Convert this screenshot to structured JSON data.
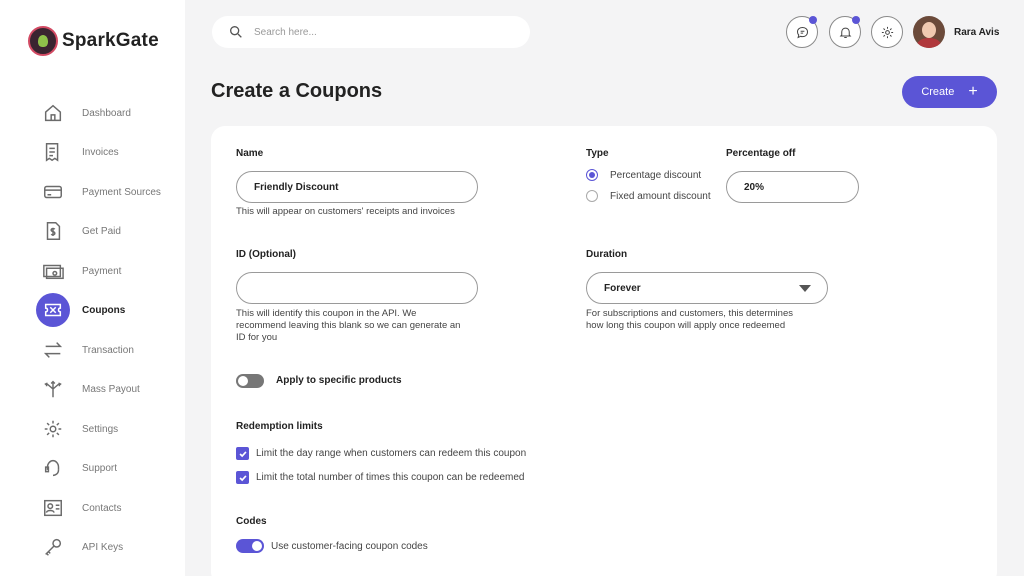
{
  "brand": {
    "name": "SparkGate"
  },
  "sidebar": {
    "items": [
      {
        "label": "Dashboard",
        "icon": "home-icon"
      },
      {
        "label": "Invoices",
        "icon": "invoice-icon"
      },
      {
        "label": "Payment Sources",
        "icon": "card-icon"
      },
      {
        "label": "Get Paid",
        "icon": "dollar-doc-icon"
      },
      {
        "label": "Payment",
        "icon": "cash-icon"
      },
      {
        "label": "Coupons",
        "icon": "coupon-icon",
        "active": true
      },
      {
        "label": "Transaction",
        "icon": "arrows-icon"
      },
      {
        "label": "Mass Payout",
        "icon": "split-arrows-icon"
      },
      {
        "label": "Settings",
        "icon": "gear-icon"
      },
      {
        "label": "Support",
        "icon": "headset-icon"
      },
      {
        "label": "Contacts",
        "icon": "contact-card-icon"
      },
      {
        "label": "API  Keys",
        "icon": "key-icon"
      }
    ]
  },
  "header": {
    "search_placeholder": "Search here...",
    "user_name": "Rara Avis"
  },
  "page": {
    "title": "Create a Coupons",
    "create_label": "Create",
    "create_icon": "+"
  },
  "form": {
    "name": {
      "label": "Name",
      "value": "Friendly Discount",
      "help": "This will appear on customers' receipts and invoices"
    },
    "id": {
      "label": "ID (Optional)",
      "value": "",
      "help_lines": [
        "This will identify this coupon in the API. We",
        "recommend leaving this blank so we can generate an",
        "ID for you"
      ]
    },
    "type": {
      "label": "Type",
      "options": [
        "Percentage discount",
        "Fixed amount discount"
      ],
      "selected": "Percentage discount"
    },
    "percentage_off": {
      "label": "Percentage off",
      "value": "20%"
    },
    "duration": {
      "label": "Duration",
      "value": "Forever",
      "help_lines": [
        "For subscriptions and customers, this determines",
        "how long this coupon will apply once redeemed"
      ]
    },
    "specific_products": {
      "label": "Apply to specific products",
      "enabled": false
    },
    "redemption": {
      "label": "Redemption limits",
      "options": [
        {
          "label": "Limit the day range when customers can redeem this coupon",
          "checked": true
        },
        {
          "label": "Limit the total number of times this coupon can be redeemed",
          "checked": true
        }
      ]
    },
    "codes": {
      "label": "Codes",
      "toggle_label": "Use customer-facing coupon codes",
      "enabled": true
    }
  },
  "colors": {
    "accent": "#5b55d6",
    "background": "#f4f4f5"
  }
}
